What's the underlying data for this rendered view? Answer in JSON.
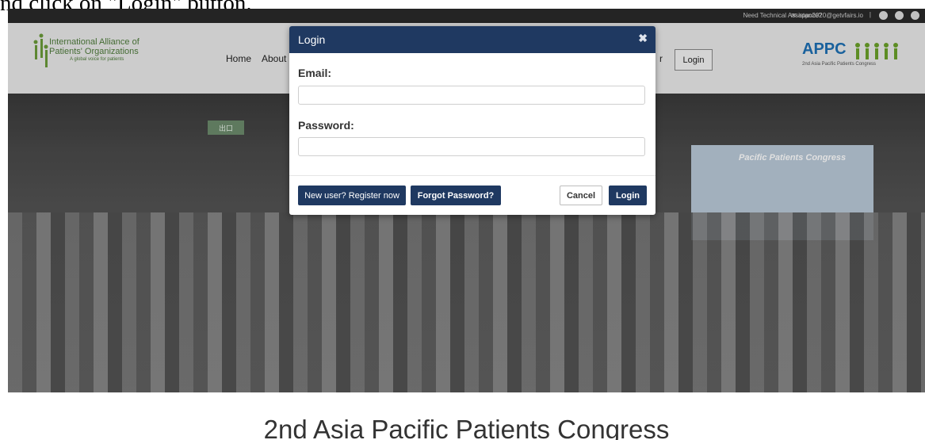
{
  "instruction": "nd click on \"Login\" button.",
  "topbar": {
    "help_text": "Need Technical Assistance?",
    "email": "appc2020@getvfairs.io",
    "separator": "|",
    "social_icons": [
      "facebook-icon",
      "twitter-icon",
      "globe-icon"
    ]
  },
  "header": {
    "org_logo": {
      "line1": "International Alliance of",
      "line2": "Patients' Organizations",
      "tagline": "A global voice for patients"
    },
    "nav": [
      {
        "label": "Home"
      },
      {
        "label": "About"
      },
      {
        "label": "r"
      }
    ],
    "login_label": "Login",
    "congress_logo": {
      "name": "APPC",
      "subtitle": "2nd Asia Pacific Patients Congress"
    }
  },
  "hero": {
    "banner_text": "Pacific Patients Congress",
    "exit_sign": "出口"
  },
  "modal": {
    "title": "Login",
    "close_symbol": "✖",
    "email_label": "Email:",
    "email_value": "",
    "password_label": "Password:",
    "password_value": "",
    "buttons": {
      "register": "New user? Register now",
      "forgot": "Forgot Password?",
      "cancel": "Cancel",
      "login": "Login"
    }
  },
  "page_title": "2nd Asia Pacific Patients Congress",
  "colors": {
    "brand_navy": "#1f3961",
    "topbar": "#2a2a2a",
    "header_bg": "#e9e9e9",
    "appc_blue": "#1d6fb3",
    "iapo_green": "#4d7a3a"
  }
}
